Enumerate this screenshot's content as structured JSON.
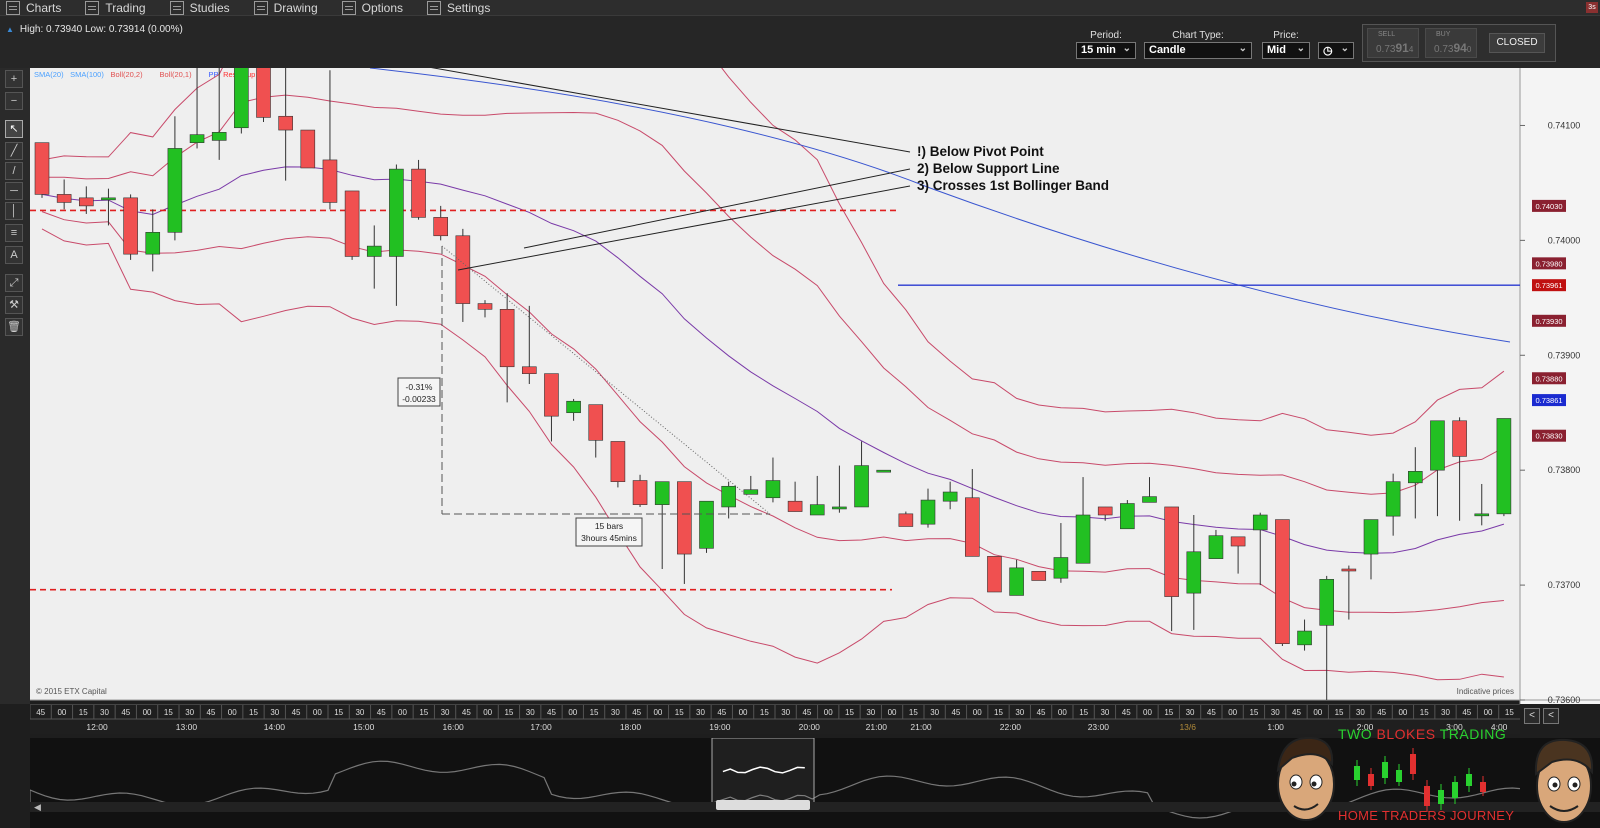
{
  "menu": {
    "items": [
      {
        "label": "Charts",
        "icon": "bar-chart-icon"
      },
      {
        "label": "Trading",
        "icon": "updown-arrows-icon"
      },
      {
        "label": "Studies",
        "icon": "studies-icon"
      },
      {
        "label": "Drawing",
        "icon": "pencil-icon"
      },
      {
        "label": "Options",
        "icon": "list-icon"
      },
      {
        "label": "Settings",
        "icon": "tools-icon"
      }
    ],
    "corner_badge": "3s"
  },
  "info": {
    "hilo": "High: 0.73940 Low: 0.73914 (0.00%)"
  },
  "controls": {
    "period": {
      "label": "Period:",
      "value": "15 min"
    },
    "chart_type": {
      "label": "Chart Type:",
      "value": "Candle"
    },
    "price": {
      "label": "Price:",
      "value": "Mid"
    }
  },
  "trade": {
    "sell_label": "SELL",
    "sell_pre": "0.73",
    "sell_big": "91",
    "sell_sub": "4",
    "buy_label": "BUY",
    "buy_pre": "0.73",
    "buy_big": "94",
    "buy_sub": "0",
    "status": "CLOSED"
  },
  "toolbar": {
    "tools": [
      "zoom-in-icon",
      "zoom-out-icon",
      "cursor-icon",
      "trendline-icon",
      "line-icon",
      "hline-icon",
      "vline-icon",
      "channel-icon",
      "text-icon",
      "fib-icon",
      "measure-icon",
      "trash-icon"
    ]
  },
  "chart": {
    "legend": [
      {
        "label": "SMA(20)",
        "color": "#4aa0ff"
      },
      {
        "label": "SMA(100)",
        "color": "#4aa0ff"
      },
      {
        "label": "Boll(20,2)",
        "color": "#e05050"
      },
      {
        "label": "Boll(20,1)",
        "color": "#e05050"
      },
      {
        "label": "PP",
        "color": "#3a5cff"
      },
      {
        "label": "Res",
        "color": "#ff3030"
      },
      {
        "label": "Sup",
        "color": "#ff3030"
      }
    ],
    "annotations": [
      "!) Below Pivot Point",
      "2) Below Support Line",
      "3) Crosses 1st Bollinger Band"
    ],
    "measure_pct": "-0.31%",
    "measure_abs": "-0.00233",
    "bars_label_1": "15 bars",
    "bars_label_2": "3hours 45mins",
    "copyright": "© 2015 ETX Capital",
    "indicative": "Indicative prices"
  },
  "chart_data": {
    "type": "candlestick",
    "ylim": [
      0.736,
      0.7415
    ],
    "y_ticks": [
      "0.74100",
      "0.74000",
      "0.73900",
      "0.73800",
      "0.73700",
      "0.73600"
    ],
    "price_tags": [
      {
        "label": "0.74030",
        "value": 0.7403,
        "color": "#8a2030"
      },
      {
        "label": "0.73980",
        "value": 0.7398,
        "color": "#8a2030"
      },
      {
        "label": "0.73961",
        "value": 0.73961,
        "color": "#c01010"
      },
      {
        "label": "0.73930",
        "value": 0.7393,
        "color": "#8a2030"
      },
      {
        "label": "0.73880",
        "value": 0.7388,
        "color": "#8a2030"
      },
      {
        "label": "0.73861",
        "value": 0.73861,
        "color": "#1a2ad0"
      },
      {
        "label": "0.73830",
        "value": 0.7383,
        "color": "#8a2030"
      }
    ],
    "resistance": 0.74026,
    "support": 0.73696,
    "pivot": 0.73961,
    "candles": [
      [
        0.74085,
        0.74085,
        0.74037,
        0.7404
      ],
      [
        0.7404,
        0.74053,
        0.74027,
        0.74033
      ],
      [
        0.74037,
        0.74047,
        0.74023,
        0.7403
      ],
      [
        0.74037,
        0.74045,
        0.74013,
        0.74037
      ],
      [
        0.74037,
        0.7404,
        0.73983,
        0.73988
      ],
      [
        0.73988,
        0.74027,
        0.73973,
        0.74007
      ],
      [
        0.74007,
        0.74108,
        0.74,
        0.7408
      ],
      [
        0.74085,
        0.74153,
        0.7408,
        0.74092
      ],
      [
        0.74087,
        0.74193,
        0.7407,
        0.74094
      ],
      [
        0.74098,
        0.74183,
        0.74093,
        0.74163
      ],
      [
        0.74163,
        0.74178,
        0.74103,
        0.74107
      ],
      [
        0.74108,
        0.74193,
        0.74052,
        0.74096
      ],
      [
        0.74096,
        0.74083,
        0.74063,
        0.74063
      ],
      [
        0.7407,
        0.74148,
        0.74027,
        0.74033
      ],
      [
        0.74043,
        0.74043,
        0.73983,
        0.73986
      ],
      [
        0.73986,
        0.74013,
        0.73958,
        0.73995
      ],
      [
        0.73986,
        0.74066,
        0.73943,
        0.74062
      ],
      [
        0.74062,
        0.7407,
        0.74018,
        0.7402
      ],
      [
        0.7402,
        0.7403,
        0.74,
        0.74004
      ],
      [
        0.74004,
        0.7401,
        0.73929,
        0.73945
      ],
      [
        0.73945,
        0.73948,
        0.73933,
        0.7394
      ],
      [
        0.7394,
        0.73954,
        0.73859,
        0.7389
      ],
      [
        0.7389,
        0.73943,
        0.73875,
        0.73884
      ],
      [
        0.73884,
        0.73884,
        0.73825,
        0.73847
      ],
      [
        0.7385,
        0.73862,
        0.73843,
        0.7386
      ],
      [
        0.73857,
        0.73857,
        0.73811,
        0.73826
      ],
      [
        0.73825,
        0.73825,
        0.73785,
        0.7379
      ],
      [
        0.73791,
        0.73796,
        0.73768,
        0.7377
      ],
      [
        0.7377,
        0.7379,
        0.73714,
        0.7379
      ],
      [
        0.7379,
        0.7379,
        0.73701,
        0.73727
      ],
      [
        0.73732,
        0.73773,
        0.73728,
        0.73773
      ],
      [
        0.73768,
        0.7379,
        0.73758,
        0.73786
      ],
      [
        0.73779,
        0.73795,
        0.73779,
        0.73783
      ],
      [
        0.73776,
        0.73811,
        0.73772,
        0.73791
      ],
      [
        0.73773,
        0.7379,
        0.73764,
        0.73764
      ],
      [
        0.73761,
        0.73795,
        0.73761,
        0.7377
      ],
      [
        0.73768,
        0.73804,
        0.73763,
        0.73768
      ],
      [
        0.73768,
        0.73825,
        0.73768,
        0.73804
      ],
      [
        0.738,
        0.738,
        0.738,
        0.738
      ],
      [
        0.73762,
        0.73764,
        0.73751,
        0.73751
      ],
      [
        0.73753,
        0.73784,
        0.7375,
        0.73774
      ],
      [
        0.73773,
        0.7379,
        0.73766,
        0.73781
      ],
      [
        0.73776,
        0.73801,
        0.7373,
        0.73725
      ],
      [
        0.73725,
        0.7372,
        0.73698,
        0.73694
      ],
      [
        0.73691,
        0.73722,
        0.73698,
        0.73715
      ],
      [
        0.73712,
        0.73712,
        0.73708,
        0.73704
      ],
      [
        0.73706,
        0.73754,
        0.73702,
        0.73724
      ],
      [
        0.73719,
        0.73794,
        0.73754,
        0.73761
      ],
      [
        0.73768,
        0.73765,
        0.73756,
        0.73761
      ],
      [
        0.73749,
        0.73774,
        0.73754,
        0.73771
      ],
      [
        0.73772,
        0.73794,
        0.73772,
        0.73777
      ],
      [
        0.73768,
        0.73768,
        0.7366,
        0.7369
      ],
      [
        0.73693,
        0.73761,
        0.73661,
        0.73729
      ],
      [
        0.73723,
        0.73748,
        0.73724,
        0.73743
      ],
      [
        0.73742,
        0.73742,
        0.7371,
        0.73734
      ],
      [
        0.73748,
        0.73763,
        0.737,
        0.73761
      ],
      [
        0.73757,
        0.73747,
        0.73647,
        0.73649
      ],
      [
        0.73648,
        0.7367,
        0.73643,
        0.7366
      ],
      [
        0.73665,
        0.73708,
        0.736,
        0.73705
      ],
      [
        0.73714,
        0.73717,
        0.7367,
        0.73713
      ],
      [
        0.73727,
        0.73757,
        0.73705,
        0.73757
      ],
      [
        0.7376,
        0.73797,
        0.73743,
        0.7379
      ],
      [
        0.73789,
        0.7382,
        0.73758,
        0.73799
      ],
      [
        0.738,
        0.73841,
        0.7376,
        0.73843
      ],
      [
        0.73843,
        0.73846,
        0.73756,
        0.73812
      ],
      [
        0.73762,
        0.73788,
        0.73752,
        0.73762
      ],
      [
        0.73762,
        0.73845,
        0.7376,
        0.73845
      ]
    ]
  },
  "time_axis": {
    "minor": [
      "45",
      "00",
      "15",
      "30",
      "45",
      "00",
      "15",
      "30",
      "45",
      "00",
      "15",
      "30",
      "45",
      "00",
      "15",
      "30",
      "45",
      "00",
      "15",
      "30",
      "45",
      "00",
      "15",
      "30",
      "45",
      "00",
      "15",
      "30",
      "45",
      "00",
      "15",
      "30",
      "45",
      "00",
      "15",
      "30",
      "45",
      "00",
      "15",
      "30",
      "00",
      "15",
      "30",
      "45",
      "00",
      "15",
      "30",
      "45",
      "00",
      "15",
      "30",
      "45",
      "00",
      "15",
      "30",
      "45",
      "00",
      "15",
      "30",
      "45",
      "00",
      "15",
      "30",
      "45",
      "00",
      "15",
      "30",
      "45",
      "00",
      "15"
    ],
    "major": [
      {
        "label": "12:00",
        "pos": 0.045
      },
      {
        "label": "13:00",
        "pos": 0.105
      },
      {
        "label": "14:00",
        "pos": 0.164
      },
      {
        "label": "15:00",
        "pos": 0.224
      },
      {
        "label": "16:00",
        "pos": 0.284
      },
      {
        "label": "17:00",
        "pos": 0.343
      },
      {
        "label": "18:00",
        "pos": 0.403
      },
      {
        "label": "19:00",
        "pos": 0.463
      },
      {
        "label": "20:00",
        "pos": 0.523
      },
      {
        "label": "21:00",
        "pos": 0.568
      },
      {
        "label": "21:00",
        "pos": 0.598
      },
      {
        "label": "22:00",
        "pos": 0.658
      },
      {
        "label": "23:00",
        "pos": 0.717
      },
      {
        "label": "13/6",
        "pos": 0.777
      },
      {
        "label": "1:00",
        "pos": 0.836
      },
      {
        "label": "2:00",
        "pos": 0.896
      },
      {
        "label": "3:00",
        "pos": 0.956
      },
      {
        "label": "4:00",
        "pos": 0.986
      }
    ]
  },
  "zoom_buttons": [
    "<",
    "<"
  ],
  "logo": {
    "top_text_1": "TWO ",
    "top_text_2": "BLOKES",
    "top_text_3": " TRADING",
    "bottom_text": "HOME TRADERS JOURNEY",
    "green": "#29d12f",
    "red": "#e23030"
  }
}
